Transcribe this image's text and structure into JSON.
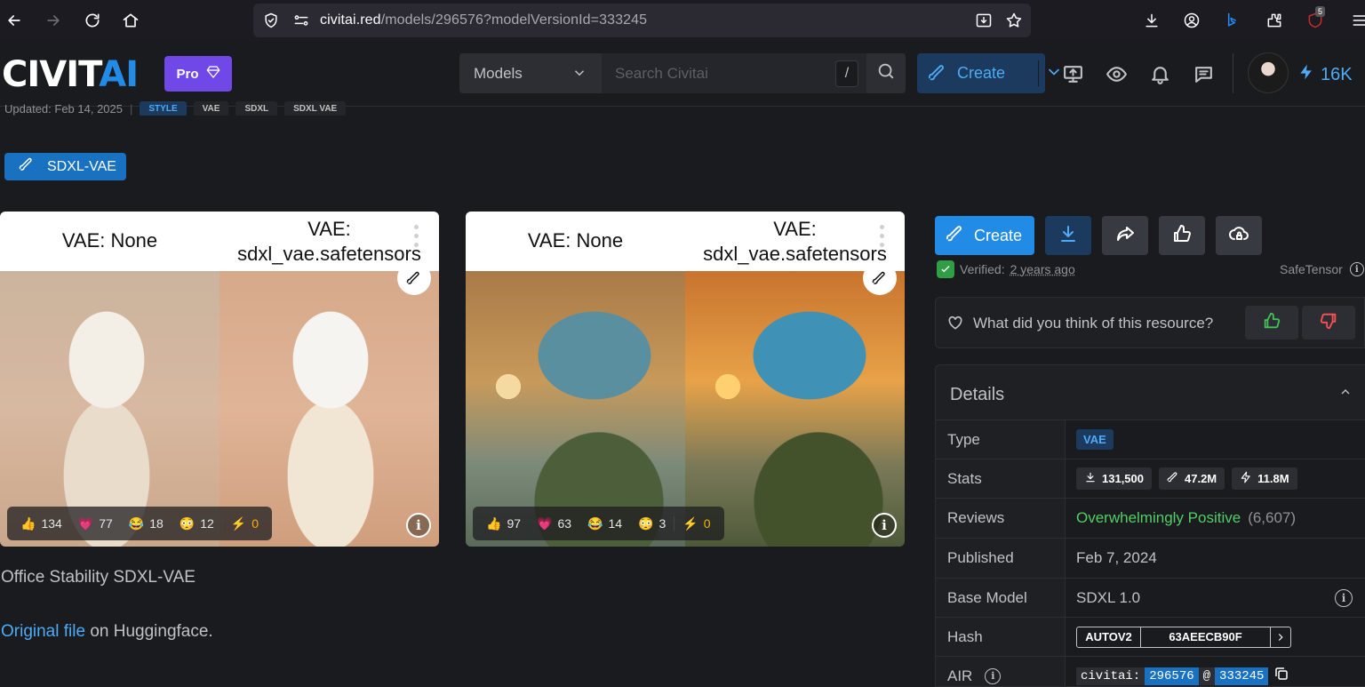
{
  "browser": {
    "url_host": "civitai.red",
    "url_path": "/models/296576?modelVersionId=333245",
    "ublock_count": "5"
  },
  "header": {
    "logo_white": "CIVIT",
    "logo_blue": "AI",
    "pro_label": "Pro",
    "search_scope": "Models",
    "search_placeholder": "Search Civitai",
    "search_shortcut": "/",
    "create_label": "Create",
    "buzz_amount": "16K"
  },
  "model": {
    "updated_text": "Updated: Feb 14, 2025",
    "tags": [
      "STYLE",
      "VAE",
      "SDXL",
      "SDXL VAE"
    ],
    "version_label": "SDXL-VAE",
    "description_line1": "Office Stability SDXL-VAE",
    "original_link": "Original file",
    "description_line2_rest": " on Huggingface."
  },
  "gallery": [
    {
      "label_left": "VAE: None",
      "label_right_1": "VAE:",
      "label_right_2": "sdxl_vae.safetensors",
      "reactions": {
        "like": "134",
        "heart": "77",
        "laugh": "18",
        "cry": "12",
        "buzz": "0"
      }
    },
    {
      "label_left": "VAE: None",
      "label_right_1": "VAE:",
      "label_right_2": "sdxl_vae.safetensors",
      "reactions": {
        "like": "97",
        "heart": "63",
        "laugh": "14",
        "cry": "3",
        "buzz": "0"
      }
    }
  ],
  "actions": {
    "create_label": "Create",
    "verified_prefix": "Verified: ",
    "verified_ago": "2 years ago",
    "safetensor": "SafeTensor",
    "feedback_question": "What did you think of this resource?"
  },
  "details": {
    "title": "Details",
    "type_key": "Type",
    "type_value": "VAE",
    "stats_key": "Stats",
    "stats_downloads": "131,500",
    "stats_generations": "47.2M",
    "stats_buzz": "11.8M",
    "reviews_key": "Reviews",
    "reviews_value": "Overwhelmingly Positive",
    "reviews_count": "(6,607)",
    "published_key": "Published",
    "published_value": "Feb 7, 2024",
    "base_key": "Base Model",
    "base_value": "SDXL 1.0",
    "hash_key": "Hash",
    "hash_type": "AUTOV2",
    "hash_value": "63AEECB90F",
    "air_key": "AIR",
    "air_prefix": "civitai:",
    "air_model": "296576",
    "air_at": "@",
    "air_version": "333245"
  },
  "colors": {
    "accent_blue": "#228be6",
    "pro_purple": "#7048e8",
    "positive_green": "#51cf66",
    "background": "#1a1b1e"
  }
}
